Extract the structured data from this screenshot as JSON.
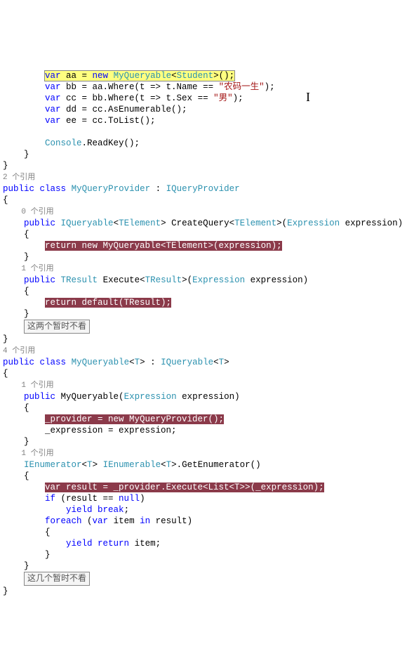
{
  "code": {
    "l01a": "        ",
    "l01b": "var",
    "l01c": " aa = ",
    "l01d": "new",
    "l01e": " ",
    "l01f": "MyQueryable",
    "l01g": "<",
    "l01h": "Student",
    "l01i": ">();",
    "l02a": "        ",
    "l02b": "var",
    "l02c": " bb = aa.Where(t => t.Name == ",
    "l02d": "\"农码一生\"",
    "l02e": ");",
    "l03a": "        ",
    "l03b": "var",
    "l03c": " cc = bb.Where(t => t.Sex == ",
    "l03d": "\"男\"",
    "l03e": ");",
    "l04a": "        ",
    "l04b": "var",
    "l04c": " dd = cc.AsEnumerable();",
    "l05a": "        ",
    "l05b": "var",
    "l05c": " ee = cc.ToList();",
    "l06": "",
    "l07a": "        ",
    "l07b": "Console",
    "l07c": ".ReadKey();",
    "l08": "    }",
    "l09": "}",
    "l10": "2 个引用",
    "l11a": "public",
    "l11b": " ",
    "l11c": "class",
    "l11d": " ",
    "l11e": "MyQueryProvider",
    "l11f": " : ",
    "l11g": "IQueryProvider",
    "l12": "{",
    "l13": "    0 个引用",
    "l14a": "    ",
    "l14b": "public",
    "l14c": " ",
    "l14d": "IQueryable",
    "l14e": "<",
    "l14f": "TElement",
    "l14g": "> CreateQuery<",
    "l14h": "TElement",
    "l14i": ">(",
    "l14j": "Expression",
    "l14k": " expression)",
    "l15": "    {",
    "l16a": "        ",
    "l16b": "return new MyQueryable<TElement>(expression);",
    "l17": "    }",
    "l18": "    1 个引用",
    "l19a": "    ",
    "l19b": "public",
    "l19c": " ",
    "l19d": "TResult",
    "l19e": " Execute<",
    "l19f": "TResult",
    "l19g": ">(",
    "l19h": "Expression",
    "l19i": " expression)",
    "l20": "    {",
    "l21a": "        ",
    "l21b": "return default(TResult);",
    "l22": "    }",
    "annot1": "这两个暂时不看",
    "l23": "}",
    "l24": "4 个引用",
    "l25a": "public",
    "l25b": " ",
    "l25c": "class",
    "l25d": " ",
    "l25e": "MyQueryable",
    "l25f": "<",
    "l25g": "T",
    "l25h": "> : ",
    "l25i": "IQueryable",
    "l25j": "<",
    "l25k": "T",
    "l25l": ">",
    "l26": "{",
    "l27": "    1 个引用",
    "l28a": "    ",
    "l28b": "public",
    "l28c": " MyQueryable(",
    "l28d": "Expression",
    "l28e": " expression)",
    "l29": "    {",
    "l30a": "        ",
    "l30b": "_provider = new MyQueryProvider();",
    "l31": "        _expression = expression;",
    "l32": "    }",
    "l33": "    1 个引用",
    "l34a": "    ",
    "l34b": "IEnumerator",
    "l34c": "<",
    "l34d": "T",
    "l34e": "> ",
    "l34f": "IEnumerable",
    "l34g": "<",
    "l34h": "T",
    "l34i": ">.GetEnumerator()",
    "l35": "    {",
    "l36a": "        ",
    "l36b": "var result = _provider.Execute<List<T>>(_expression);",
    "l37a": "        ",
    "l37b": "if",
    "l37c": " (result == ",
    "l37d": "null",
    "l37e": ")",
    "l38a": "            ",
    "l38b": "yield",
    "l38c": " ",
    "l38d": "break",
    "l38e": ";",
    "l39a": "        ",
    "l39b": "foreach",
    "l39c": " (",
    "l39d": "var",
    "l39e": " item ",
    "l39f": "in",
    "l39g": " result)",
    "l40": "        {",
    "l41a": "            ",
    "l41b": "yield",
    "l41c": " ",
    "l41d": "return",
    "l41e": " item;",
    "l42": "        }",
    "l43": "    }",
    "annot2": "这几个暂时不看",
    "l44": "}"
  },
  "cursor": "I"
}
